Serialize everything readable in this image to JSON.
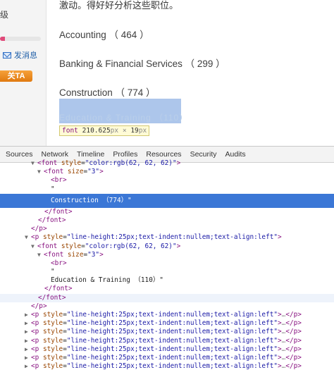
{
  "page": {
    "left": {
      "top_text": "级",
      "progress_fraction": 0.12,
      "message_link": "发消息",
      "ta_button": "关TA"
    },
    "intro_text": "激动。得好好分析这些职位。",
    "categories": [
      {
        "label": "Accounting （ 464 ）"
      },
      {
        "label": "Banking & Financial Services （ 299 ）"
      },
      {
        "label": "Construction （ 774 ）"
      }
    ],
    "highlight_ghost": "Education & Training （110）",
    "tooltip": {
      "tag": "font",
      "size": "210.625",
      "unit1": "px",
      "times": "×",
      "h": "19",
      "unit2": "px"
    }
  },
  "devtools": {
    "tabs": [
      "Sources",
      "Network",
      "Timeline",
      "Profiles",
      "Resources",
      "Security",
      "Audits"
    ]
  },
  "dom": {
    "l0": {
      "tag": "font",
      "attr": "style",
      "val": "\"color:rgb(62, 62, 62)\""
    },
    "l1": {
      "tag": "font",
      "attr": "size",
      "val": "\"3\""
    },
    "l2": {
      "tag": "br"
    },
    "l3": {
      "text": "\""
    },
    "l4": {
      "text": "Construction （774）\""
    },
    "l5": {
      "tag": "font"
    },
    "l6": {
      "tag": "font"
    },
    "l7": {
      "tag": "p"
    },
    "l8": {
      "tag": "p",
      "attr": "style",
      "val": "\"line-height:25px;text-indent:nullem;text-align:left\""
    },
    "l9": {
      "tag": "font",
      "attr": "style",
      "val": "\"color:rgb(62, 62, 62)\""
    },
    "l10": {
      "tag": "font",
      "attr": "size",
      "val": "\"3\""
    },
    "l11": {
      "tag": "br"
    },
    "l12": {
      "text": "\""
    },
    "l13": {
      "text": "Education & Training （110）\""
    },
    "l14": {
      "tag": "font"
    },
    "l15": {
      "tag": "font"
    },
    "l16": {
      "tag": "p"
    },
    "collapsed_p": {
      "tag": "p",
      "attr": "style",
      "val": "\"line-height:25px;text-indent:nullem;text-align:left\"",
      "ellipsis": "…"
    }
  },
  "colors": {
    "selection": "#3b77d6",
    "highlight": "#a9c4ea",
    "tag": "#881280",
    "attr": "#994500",
    "value": "#1a1aa6"
  }
}
